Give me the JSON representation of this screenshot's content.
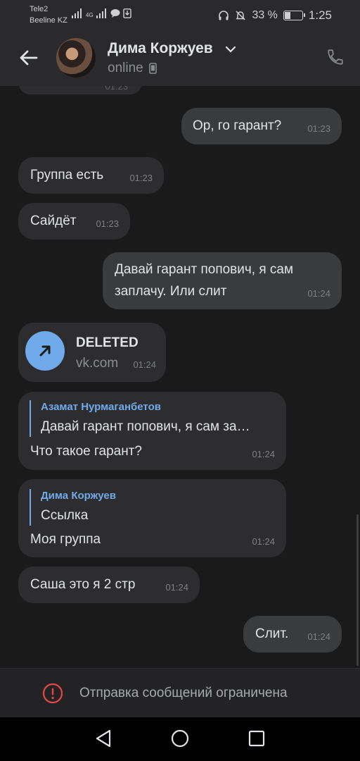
{
  "status_bar": {
    "carrier1": "Tele2",
    "carrier2": "Beeline KZ",
    "net_type": "4G",
    "battery": "33 %",
    "battery_level": 0.33,
    "time": "1:25"
  },
  "header": {
    "name": "Дима Коржуев",
    "status": "online"
  },
  "messages": {
    "m1": {
      "text": "Ор, го гарант?",
      "time": "01:23"
    },
    "m2": {
      "text": "Группа есть",
      "time": "01:23"
    },
    "m3": {
      "text": "Сайдёт",
      "time": "01:23"
    },
    "m4": {
      "line1": "Давай гарант попович, я сам",
      "line2": "заплачу. Или слит",
      "time": "01:24"
    },
    "m5": {
      "title": "DELETED",
      "domain": "vk.com",
      "time": "01:24"
    },
    "m6": {
      "quote_author": "Азамат Нурмаганбетов",
      "quote_text": "Давай гарант попович, я сам за…",
      "text": "Что такое гарант?",
      "time": "01:24"
    },
    "m7": {
      "quote_author": "Дима Коржуев",
      "quote_text": "Ссылка",
      "text": "Моя группа",
      "time": "01:24"
    },
    "m8": {
      "text": "Саша это я 2 стр",
      "time": "01:24"
    },
    "m9": {
      "text": "Слит.",
      "time": "01:24"
    }
  },
  "restricted": {
    "text": "Отправка сообщений ограничена"
  },
  "colors": {
    "accent": "#71aaeb",
    "background": "#1a1a1a",
    "incoming": "#2d2d2f",
    "outgoing": "#3a3b3d",
    "error": "#e64646"
  }
}
